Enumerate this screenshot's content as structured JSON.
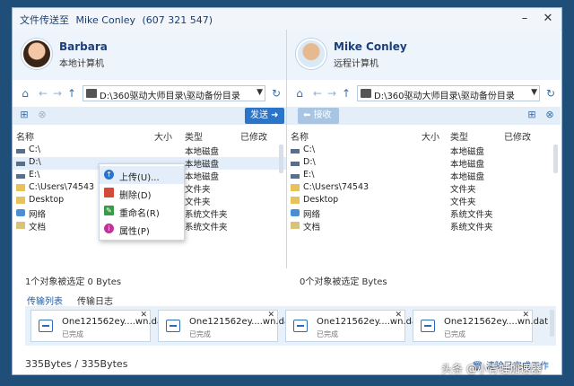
{
  "window": {
    "title": "文件传送至",
    "contact_name": "Mike Conley",
    "contact_number": "(607 321 547)",
    "minimize_icon": "minimize-icon",
    "close_icon": "close-icon"
  },
  "left_pane": {
    "user_name": "Barbara",
    "user_type": "本地计算机",
    "path": "D:\\360驱动大师目录\\驱动备份目录",
    "send_label": "发送",
    "columns": {
      "name": "名称",
      "size": "大小",
      "type": "类型",
      "modified": "已修改"
    },
    "rows": [
      {
        "name": "C:\\",
        "type": "本地磁盘",
        "icon": "drive-icon"
      },
      {
        "name": "D:\\",
        "type": "本地磁盘",
        "icon": "drive-icon"
      },
      {
        "name": "E:\\",
        "type": "本地磁盘",
        "icon": "drive-icon"
      },
      {
        "name": "C:\\Users\\74543",
        "type": "文件夹",
        "icon": "folder-icon"
      },
      {
        "name": "Desktop",
        "type": "文件夹",
        "icon": "folder-icon"
      },
      {
        "name": "网络",
        "type": "系统文件夹",
        "icon": "network-icon"
      },
      {
        "name": "文档",
        "type": "系统文件夹",
        "icon": "document-icon"
      }
    ],
    "status": "1个对象被选定 0 Bytes"
  },
  "right_pane": {
    "user_name": "Mike Conley",
    "user_type": "远程计算机",
    "path": "D:\\360驱动大师目录\\驱动备份目录",
    "receive_label": "接收",
    "columns": {
      "name": "名称",
      "size": "大小",
      "type": "类型",
      "modified": "已修改"
    },
    "rows": [
      {
        "name": "C:\\",
        "type": "本地磁盘",
        "icon": "drive-icon"
      },
      {
        "name": "D:\\",
        "type": "本地磁盘",
        "icon": "drive-icon"
      },
      {
        "name": "E:\\",
        "type": "本地磁盘",
        "icon": "drive-icon"
      },
      {
        "name": "C:\\Users\\74543",
        "type": "文件夹",
        "icon": "folder-icon"
      },
      {
        "name": "Desktop",
        "type": "文件夹",
        "icon": "folder-icon"
      },
      {
        "name": "网络",
        "type": "系统文件夹",
        "icon": "network-icon"
      },
      {
        "name": "文档",
        "type": "系统文件夹",
        "icon": "document-icon"
      }
    ],
    "status": "0个对象被选定 Bytes"
  },
  "context_menu": [
    {
      "label": "上传(U)...",
      "icon": "upload-icon",
      "color": "#2b74c8"
    },
    {
      "label": "删除(D)",
      "icon": "delete-icon",
      "color": "#d24b3a"
    },
    {
      "label": "重命名(R)",
      "icon": "rename-icon",
      "color": "#3a9a4a"
    },
    {
      "label": "属性(P)",
      "icon": "properties-icon",
      "color": "#c2339a"
    }
  ],
  "tabs": {
    "transfer_list": "传输列表",
    "transfer_log": "传输日志"
  },
  "transfers": [
    {
      "name": "One121562ey....wn.dat",
      "status": "已完成"
    },
    {
      "name": "One121562ey....wn.dat",
      "status": "已完成"
    },
    {
      "name": "One121562ey....wn.dat",
      "status": "已完成"
    },
    {
      "name": "One121562ey....wn.dat",
      "status": "已完成"
    }
  ],
  "footer": {
    "bytes": "335Bytes  /  335Bytes",
    "clear_label": "清除已完成工作"
  },
  "watermark": "头条 @小青蛙加速器",
  "colors": {
    "accent": "#2b74c8",
    "title": "#1b3f7a",
    "background": "#1f4e79"
  }
}
